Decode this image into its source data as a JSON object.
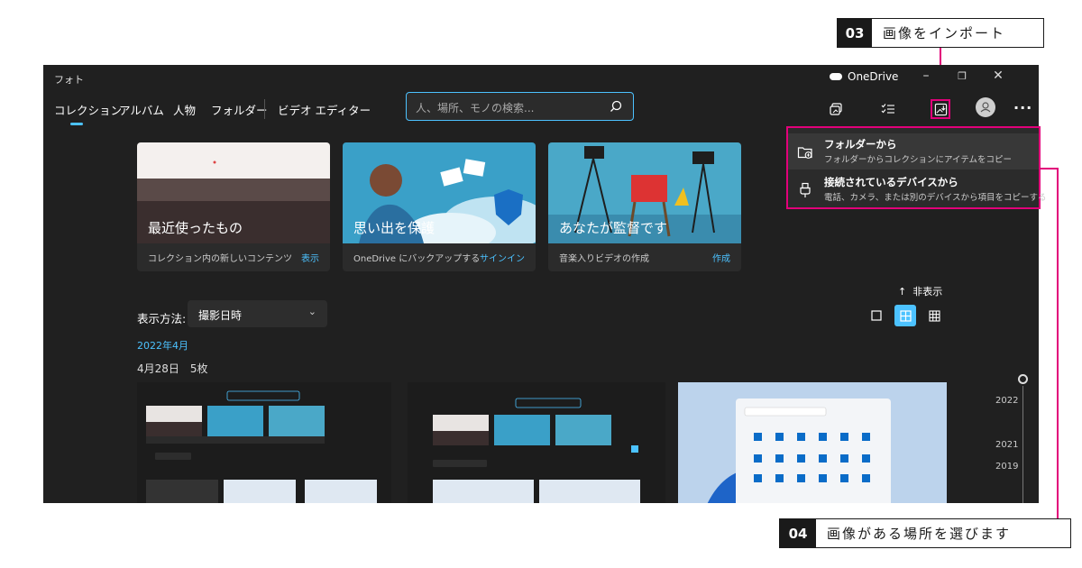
{
  "callouts": {
    "c03": {
      "num": "03",
      "text": "画像をインポート"
    },
    "c04": {
      "num": "04",
      "text": "画像がある場所を選びます"
    }
  },
  "window": {
    "title": "フォト",
    "onedrive": "OneDrive",
    "controls": {
      "minimize": "–",
      "maximize": "❐",
      "close": "✕"
    }
  },
  "nav": {
    "items": [
      "コレクション",
      "アルバム",
      "人物",
      "フォルダー",
      "ビデオ エディター"
    ],
    "active": "コレクション"
  },
  "search": {
    "placeholder": "人、場所、モノの検索..."
  },
  "toolbar": {
    "icons": [
      "slideshow-icon",
      "select-icon",
      "import-icon",
      "account-icon",
      "more-icon"
    ],
    "more": "···"
  },
  "cards": [
    {
      "title": "最近使ったもの",
      "desc": "コレクション内の新しいコンテンツ",
      "action": "表示"
    },
    {
      "title": "思い出を保護",
      "desc": "OneDrive にバックアップする",
      "action": "サインイン"
    },
    {
      "title": "あなたが監督です",
      "desc": "音楽入りビデオの作成",
      "action": "作成"
    }
  ],
  "view": {
    "label": "表示方法:",
    "value": "撮影日時",
    "hide": "非表示",
    "month": "2022年4月",
    "day": "4月28日　5枚"
  },
  "timeline": {
    "years": [
      "2022",
      "2021",
      "2019"
    ]
  },
  "menu": {
    "items": [
      {
        "label": "フォルダーから",
        "sub": "フォルダーからコレクションにアイテムをコピー"
      },
      {
        "label": "接続されているデバイスから",
        "sub": "電話、カメラ、または別のデバイスから項目をコピーする"
      }
    ]
  },
  "colors": {
    "accent": "#4cc2ff",
    "highlight": "#e2007a",
    "background": "#202020"
  }
}
